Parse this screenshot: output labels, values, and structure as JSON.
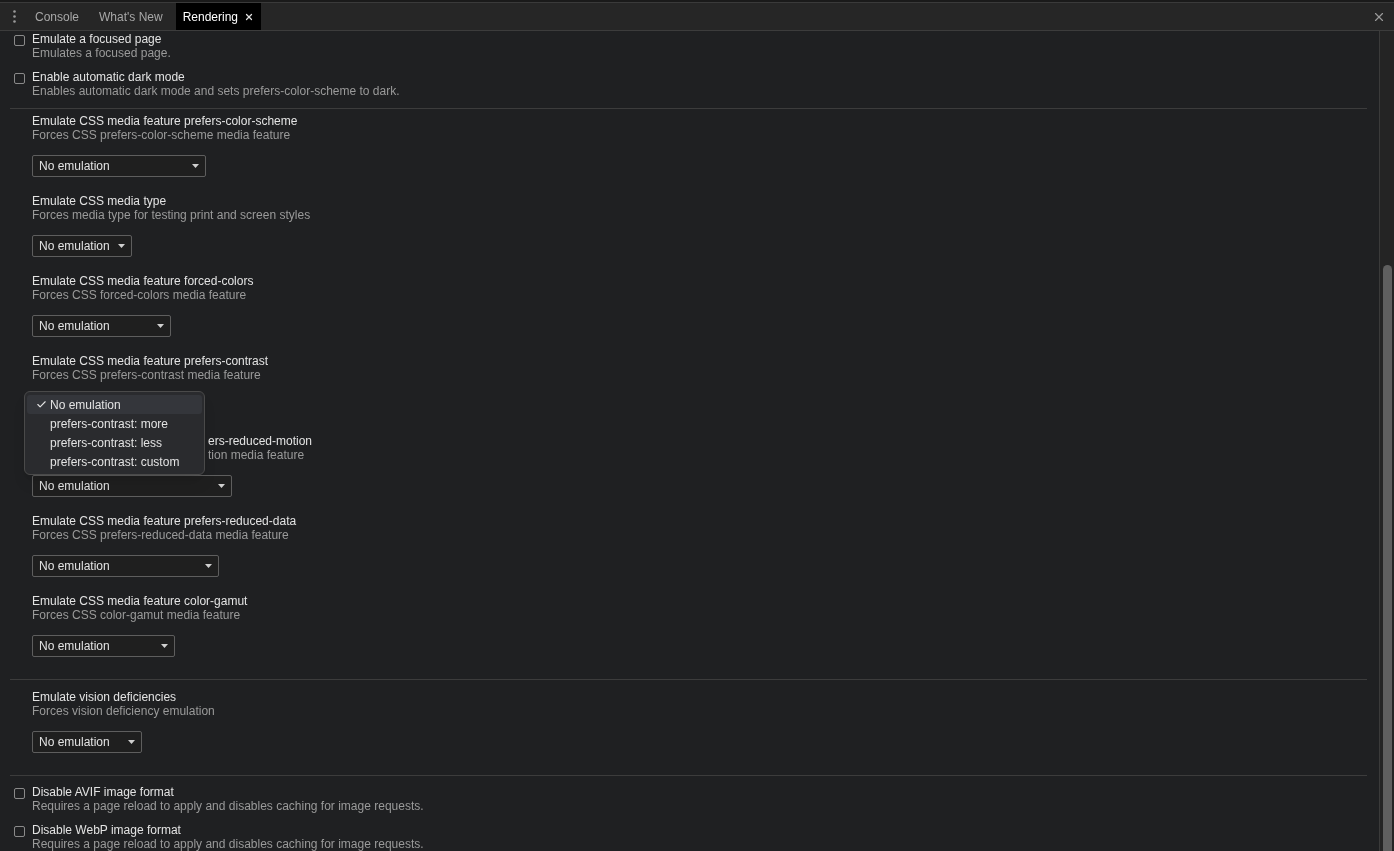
{
  "tabs": [
    {
      "label": "Console",
      "selected": false,
      "closable": false
    },
    {
      "label": "What's New",
      "selected": false,
      "closable": false
    },
    {
      "label": "Rendering",
      "selected": true,
      "closable": true
    }
  ],
  "groups": [
    {
      "items": [
        {
          "kind": "checkbox",
          "title": "Emulate a focused page",
          "description": "Emulates a focused page.",
          "checked": false
        },
        {
          "kind": "checkbox",
          "title": "Enable automatic dark mode",
          "description": "Enables automatic dark mode and sets prefers-color-scheme to dark.",
          "checked": false
        }
      ]
    },
    {
      "items": [
        {
          "kind": "select",
          "title": "Emulate CSS media feature prefers-color-scheme",
          "description": "Forces CSS prefers-color-scheme media feature",
          "value": "No emulation",
          "open": false
        },
        {
          "kind": "select",
          "title": "Emulate CSS media type",
          "description": "Forces media type for testing print and screen styles",
          "value": "No emulation",
          "open": false
        },
        {
          "kind": "select",
          "title": "Emulate CSS media feature forced-colors",
          "description": "Forces CSS forced-colors media feature",
          "value": "No emulation",
          "open": false
        },
        {
          "kind": "select",
          "title": "Emulate CSS media feature prefers-contrast",
          "description": "Forces CSS prefers-contrast media feature",
          "open": true,
          "menu": [
            {
              "label": "No emulation",
              "selected": true
            },
            {
              "label": "prefers-contrast: more",
              "selected": false
            },
            {
              "label": "prefers-contrast: less",
              "selected": false
            },
            {
              "label": "prefers-contrast: custom",
              "selected": false
            }
          ]
        },
        {
          "kind": "select",
          "title": "ers-reduced-motion",
          "description": "tion media feature",
          "value": "No emulation",
          "open": false,
          "partly_covered": true
        },
        {
          "kind": "select",
          "title": "Emulate CSS media feature prefers-reduced-data",
          "description": "Forces CSS prefers-reduced-data media feature",
          "value": "No emulation",
          "open": false
        },
        {
          "kind": "select",
          "title": "Emulate CSS media feature color-gamut",
          "description": "Forces CSS color-gamut media feature",
          "value": "No emulation",
          "open": false
        }
      ]
    },
    {
      "items": [
        {
          "kind": "select",
          "title": "Emulate vision deficiencies",
          "description": "Forces vision deficiency emulation",
          "value": "No emulation",
          "open": false
        }
      ]
    },
    {
      "items": [
        {
          "kind": "checkbox",
          "title": "Disable AVIF image format",
          "description": "Requires a page reload to apply and disables caching for image requests.",
          "checked": false
        },
        {
          "kind": "checkbox",
          "title": "Disable WebP image format",
          "description": "Requires a page reload to apply and disables caching for image requests.",
          "checked": false
        }
      ]
    }
  ]
}
